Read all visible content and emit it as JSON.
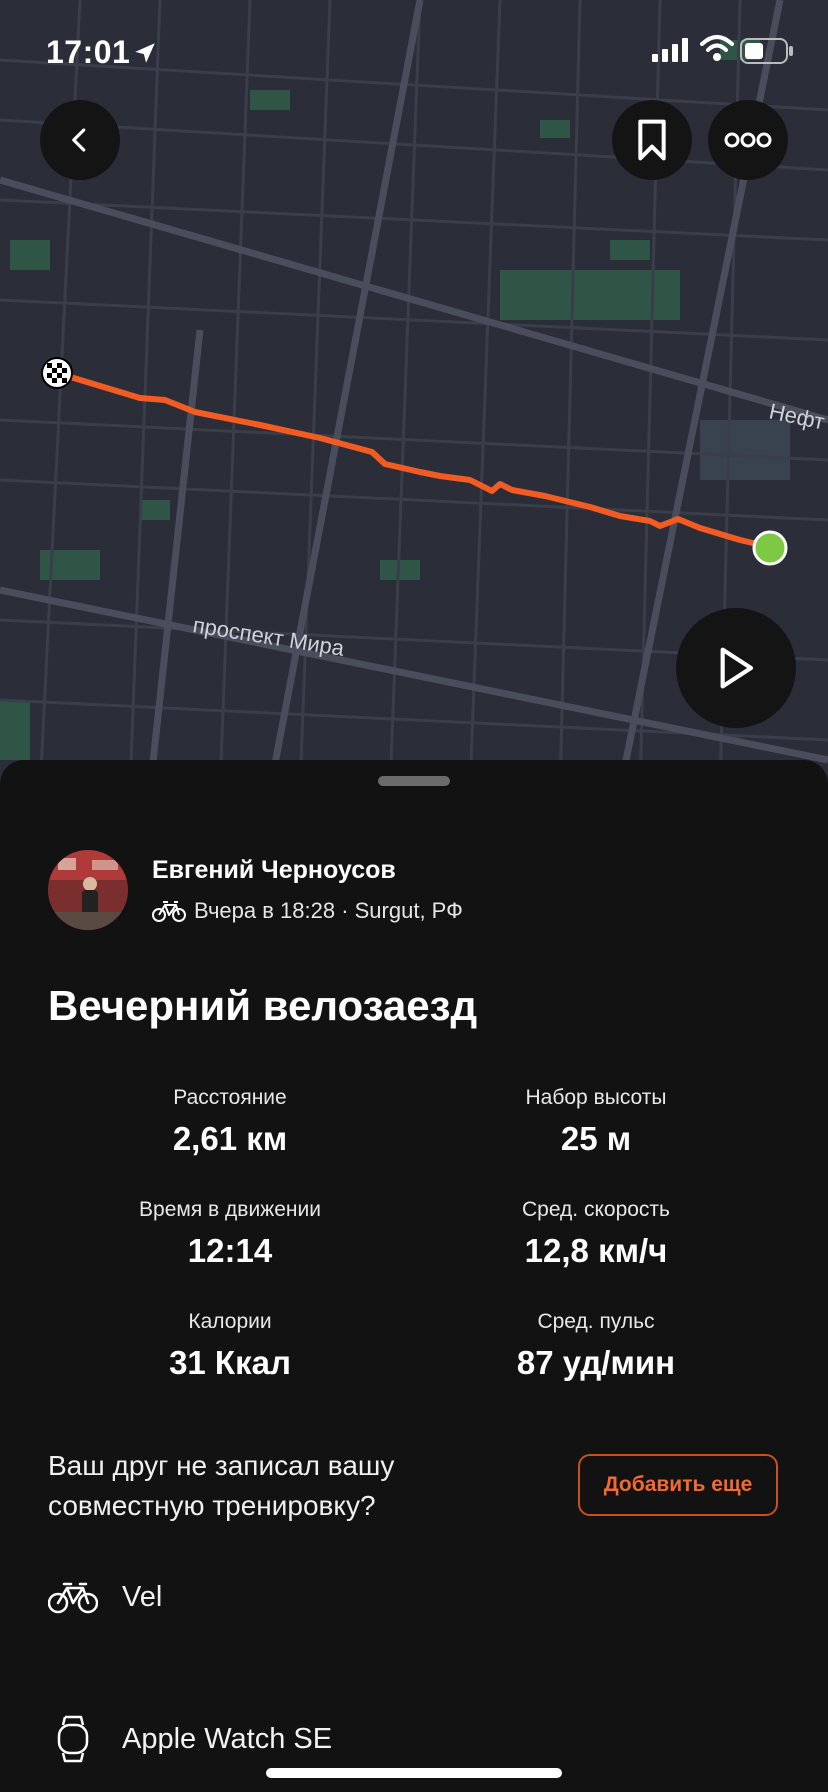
{
  "status_bar": {
    "time": "17:01"
  },
  "map": {
    "street_labels": [
      "проспект Мира",
      "Нефт"
    ],
    "route_color": "#f25c22",
    "end_marker_color": "#7dc944"
  },
  "buttons": {
    "back_icon": "chevron-left-icon",
    "bookmark_icon": "bookmark-icon",
    "more_icon": "more-dots-icon",
    "play_icon": "play-icon"
  },
  "activity": {
    "user_name": "Евгений Черноусов",
    "meta": "Вчера в 18:28 · Surgut, РФ",
    "title": "Вечерний велозаезд",
    "stats": [
      {
        "label": "Расстояние",
        "value": "2,61 км"
      },
      {
        "label": "Набор высоты",
        "value": "25 м"
      },
      {
        "label": "Время в движении",
        "value": "12:14"
      },
      {
        "label": "Сред. скорость",
        "value": "12,8 км/ч"
      },
      {
        "label": "Калории",
        "value": "31 Ккал"
      },
      {
        "label": "Сред. пульс",
        "value": "87 уд/мин"
      }
    ],
    "friend_prompt": "Ваш друг не записал вашу совместную тренировку?",
    "add_button_label": "Добавить еще",
    "gear": {
      "bike": "Vel",
      "device": "Apple Watch SE"
    }
  },
  "colors": {
    "accent": "#f26a2f",
    "background": "#121212"
  }
}
